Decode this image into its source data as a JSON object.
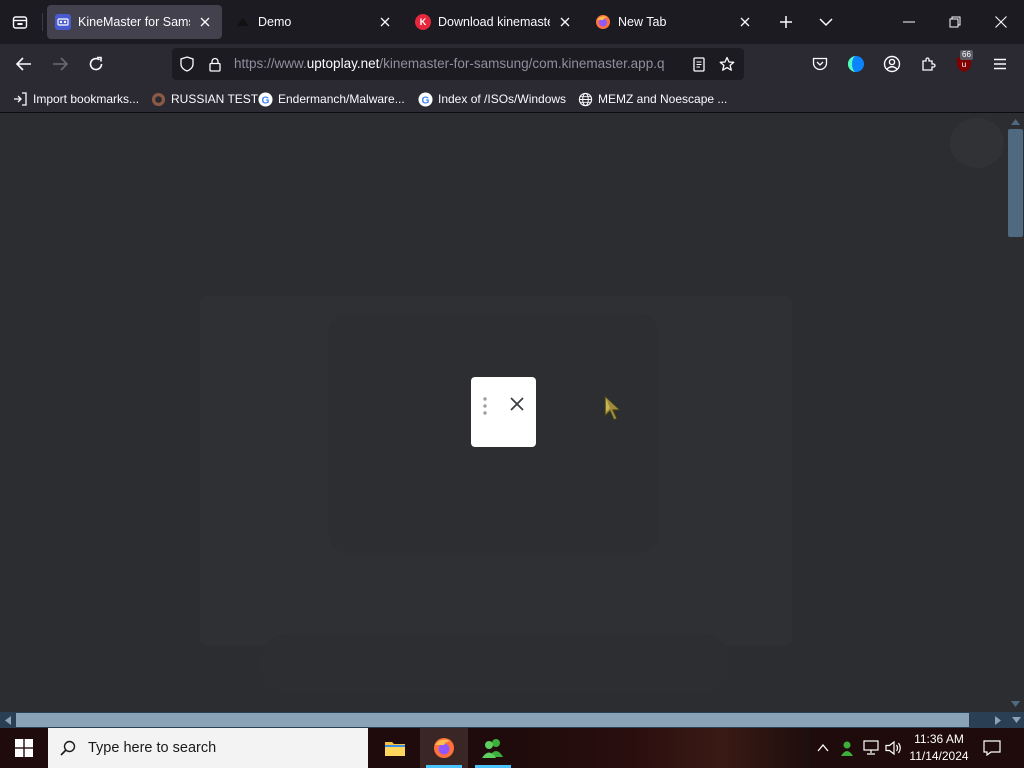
{
  "tabs": [
    {
      "title": "KineMaster for Samsung",
      "active": true,
      "favicon": "uptoplay-icon"
    },
    {
      "title": "Demo",
      "active": false,
      "favicon": "demo-icon"
    },
    {
      "title": "Download kinemaster",
      "active": false,
      "favicon": "kinemaster-icon"
    },
    {
      "title": "New Tab",
      "active": false,
      "favicon": "firefox-icon"
    }
  ],
  "url": {
    "prefix": "https://www.",
    "domain": "uptoplay.net",
    "path": "/kinemaster-for-samsung/com.kinemaster.app.q"
  },
  "extensions_badge": "66",
  "bookmarks": [
    {
      "label": "Import bookmarks...",
      "icon": "import-icon"
    },
    {
      "label": "RUSSIAN TEST",
      "icon": "github-icon"
    },
    {
      "label": "Endermanch/Malware...",
      "icon": "google-icon"
    },
    {
      "label": "Index of /ISOs/Windows",
      "icon": "google-icon"
    },
    {
      "label": "MEMZ and Noescape ...",
      "icon": "globe-icon"
    }
  ],
  "taskbar": {
    "search_placeholder": "Type here to search",
    "time": "11:36 AM",
    "date": "11/14/2024"
  },
  "colors": {
    "accent": "#0a84ff",
    "content_bg": "#2b2d31",
    "firefox_underline": "#4cc2ff"
  }
}
